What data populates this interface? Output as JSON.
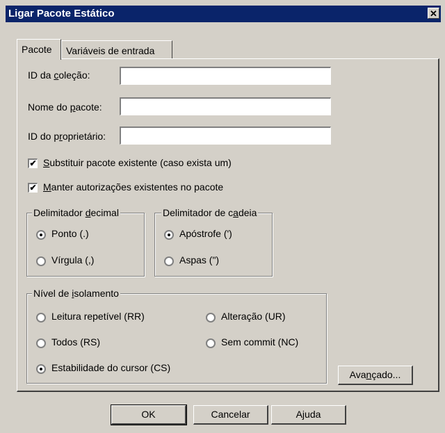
{
  "window": {
    "title": "Ligar Pacote Estático",
    "close_glyph": "✕"
  },
  "tabs": [
    {
      "label": "Pacote",
      "active": true
    },
    {
      "label": "Variáveis de entrada",
      "active": false
    }
  ],
  "fields": {
    "collection_id": {
      "label_pre": "ID da ",
      "label_acc": "c",
      "label_post": "oleção:",
      "value": ""
    },
    "package_name": {
      "label_pre": "Nome do ",
      "label_acc": "p",
      "label_post": "acote:",
      "value": ""
    },
    "owner_id": {
      "label_pre": "ID do p",
      "label_acc": "r",
      "label_post": "oprietário:",
      "value": ""
    }
  },
  "checkboxes": {
    "replace": {
      "label_acc": "S",
      "label_post": "ubstituir pacote existente (caso exista um)",
      "checked": true
    },
    "keep_auth": {
      "label_acc": "M",
      "label_post": "anter autorizações existentes no pacote",
      "checked": true
    }
  },
  "decimal_group": {
    "legend_pre": "Delimitador ",
    "legend_acc": "d",
    "legend_post": "ecimal",
    "options": [
      {
        "label": "Ponto (.)",
        "selected": true
      },
      {
        "label": "Vírgula (,)",
        "selected": false
      }
    ]
  },
  "string_group": {
    "legend_pre": "Delimitador de c",
    "legend_acc": "a",
    "legend_post": "deia",
    "options": [
      {
        "label": "Apóstrofe (')",
        "selected": true
      },
      {
        "label": "Aspas (\")",
        "selected": false
      }
    ]
  },
  "isolation_group": {
    "legend_pre": "Nível de ",
    "legend_acc": "i",
    "legend_post": "solamento",
    "options": {
      "rr": {
        "label": "Leitura repetível (RR)",
        "selected": false
      },
      "ur": {
        "label": "Alteração (UR)",
        "selected": false
      },
      "rs": {
        "label": "Todos (RS)",
        "selected": false
      },
      "nc": {
        "label": "Sem commit (NC)",
        "selected": false
      },
      "cs": {
        "label": "Estabilidade do cursor (CS)",
        "selected": true
      }
    }
  },
  "advanced_button": {
    "label_pre": "Ava",
    "label_acc": "n",
    "label_post": "çado..."
  },
  "footer": {
    "ok": "OK",
    "cancel": "Cancelar",
    "help": "Ajuda"
  }
}
